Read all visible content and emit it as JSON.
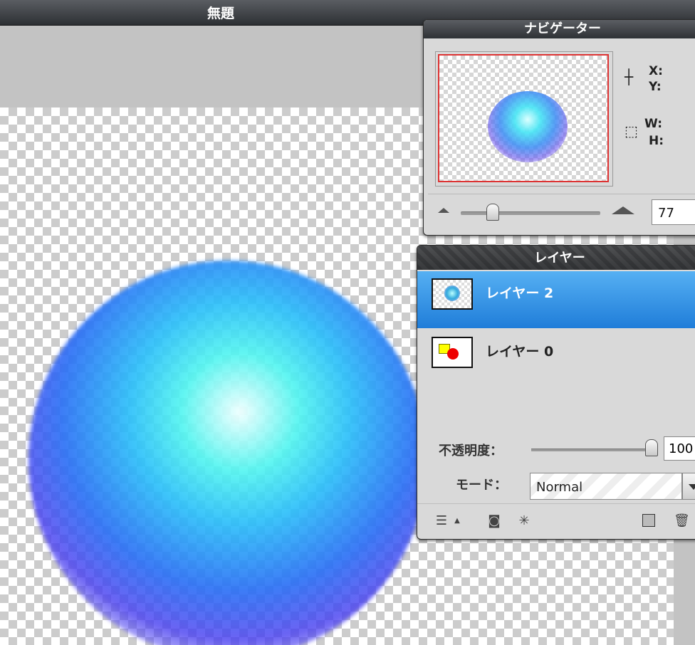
{
  "document": {
    "title": "無題"
  },
  "navigator": {
    "title": "ナビゲーター",
    "x_label": "X:",
    "y_label": "Y:",
    "w_label": "W:",
    "h_label": "H:",
    "zoom_value": "77"
  },
  "layers": {
    "title": "レイヤー",
    "items": [
      {
        "name": "レイヤー 2",
        "selected": true
      },
      {
        "name": "レイヤー 0",
        "selected": false
      }
    ],
    "opacity_label": "不透明度：",
    "opacity_value": "100",
    "mode_label": "モード：",
    "mode_value": "Normal"
  },
  "icons": {
    "crosshair": "crosshair-icon",
    "selection": "selection-size-icon",
    "zoom_out": "small-mountain-icon",
    "zoom_in": "large-mountain-icon",
    "layer_styles": "layer-styles-icon",
    "mask": "layer-mask-icon",
    "adjustment": "adjustment-icon",
    "new_layer": "new-layer-icon",
    "trash": "trash-icon"
  },
  "colors": {
    "selection_blue": "#1f7dd9",
    "nav_frame": "#dd3333"
  }
}
